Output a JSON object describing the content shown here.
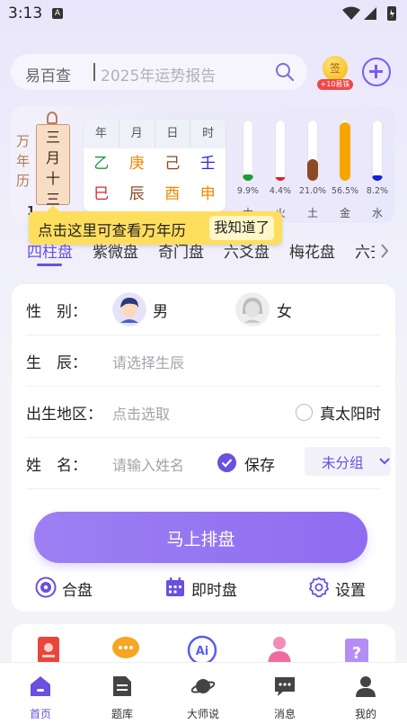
{
  "status": {
    "time": "3:13",
    "notif_letter": "A"
  },
  "search": {
    "brand": "易百查",
    "placeholder": "2025年运势报告"
  },
  "sign_in": {
    "coin_label": "签",
    "badge": "+10易铢"
  },
  "calendar": {
    "title_vertical": "万年历",
    "lunar_month": "三月",
    "lunar_day": "十三",
    "day_number": "1",
    "bazi": {
      "headers": [
        "年",
        "月",
        "日",
        "时"
      ],
      "stems": [
        "乙",
        "庚",
        "己",
        "壬"
      ],
      "branches": [
        "巳",
        "辰",
        "酉",
        "申"
      ]
    },
    "elements": [
      {
        "name": "木",
        "percent": "9.9%",
        "value": 9.9,
        "color": "#1c9a3a"
      },
      {
        "name": "火",
        "percent": "4.4%",
        "value": 4.4,
        "color": "#d8262f"
      },
      {
        "name": "土",
        "percent": "21.0%",
        "value": 21.0,
        "color": "#8a4a22"
      },
      {
        "name": "金",
        "percent": "56.5%",
        "value": 56.5,
        "color": "#f7a600"
      },
      {
        "name": "水",
        "percent": "8.2%",
        "value": 8.2,
        "color": "#1b22d8"
      }
    ]
  },
  "tooltip": {
    "text": "点击这里可查看万年历",
    "ok": "我知道了"
  },
  "tabs": [
    "四柱盘",
    "紫微盘",
    "奇门盘",
    "六爻盘",
    "梅花盘",
    "六壬"
  ],
  "form": {
    "gender_label": "性　别：",
    "male": "男",
    "female": "女",
    "birth_label": "生　辰：",
    "birth_placeholder": "请选择生辰",
    "place_label": "出生地区：",
    "place_placeholder": "点击选取",
    "solar_time": "真太阳时",
    "name_label": "姓　名：",
    "name_placeholder": "请输入姓名",
    "save": "保存",
    "group": "未分组",
    "submit": "马上排盘",
    "tools": [
      "合盘",
      "即时盘",
      "设置"
    ]
  },
  "nav": [
    "首页",
    "题库",
    "大师说",
    "消息",
    "我的"
  ],
  "colors": {
    "accent": "#6a4fe0",
    "button": "#9478f1",
    "tooltip": "#ffde5e"
  }
}
